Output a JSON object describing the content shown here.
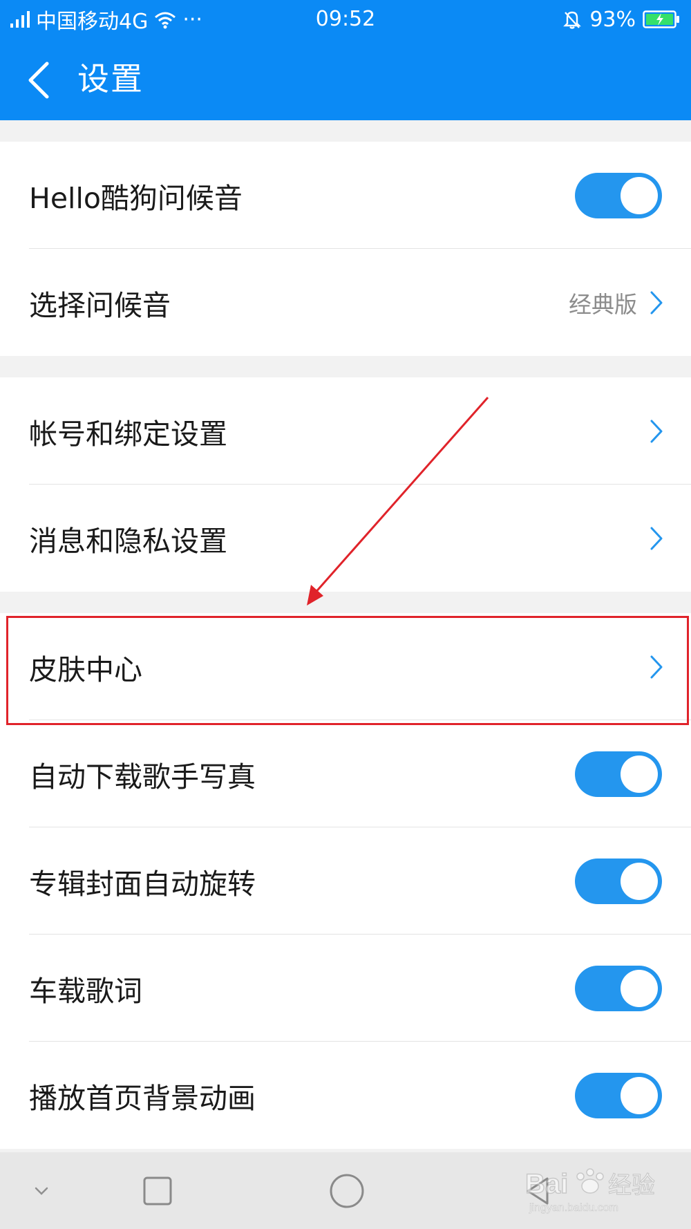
{
  "status_bar": {
    "carrier": "中国移动4G",
    "dots": "···",
    "time": "09:52",
    "battery": "93%"
  },
  "header": {
    "title": "设置"
  },
  "settings": {
    "group1": [
      {
        "label": "Hello酷狗问候音",
        "control": "toggle",
        "on": true
      },
      {
        "label": "选择问候音",
        "value": "经典版",
        "control": "chevron"
      }
    ],
    "group2": [
      {
        "label": "帐号和绑定设置",
        "control": "chevron"
      },
      {
        "label": "消息和隐私设置",
        "control": "chevron"
      }
    ],
    "group3": [
      {
        "label": "皮肤中心",
        "control": "chevron"
      },
      {
        "label": "自动下载歌手写真",
        "control": "toggle",
        "on": true
      },
      {
        "label": "专辑封面自动旋转",
        "control": "toggle",
        "on": true
      },
      {
        "label": "车载歌词",
        "control": "toggle",
        "on": true
      },
      {
        "label": "播放首页背景动画",
        "control": "toggle",
        "on": true
      }
    ]
  },
  "watermark": {
    "brand": "Bai",
    "brand2": "经验",
    "url": "jingyan.baidu.com"
  },
  "colors": {
    "primary": "#0b8af5",
    "toggle_on": "#2496ee",
    "annotation": "#e0232a"
  }
}
